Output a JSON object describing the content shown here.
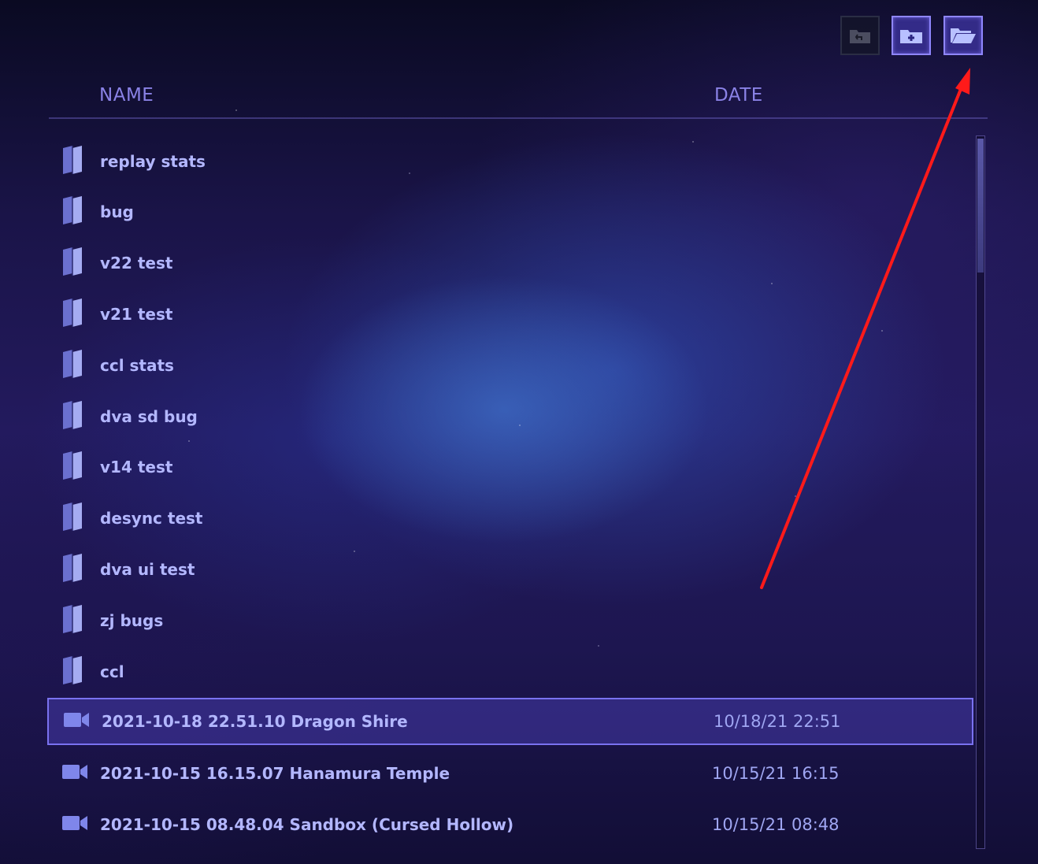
{
  "toolbar": {
    "buttons": [
      {
        "icon": "folder-back-icon",
        "state": "disabled"
      },
      {
        "icon": "new-folder-icon",
        "state": "enabled"
      },
      {
        "icon": "open-folder-icon",
        "state": "enabled"
      }
    ]
  },
  "header": {
    "name_label": "NAME",
    "date_label": "DATE"
  },
  "folders": [
    {
      "name": "replay stats"
    },
    {
      "name": "bug"
    },
    {
      "name": "v22 test"
    },
    {
      "name": "v21 test"
    },
    {
      "name": "ccl stats"
    },
    {
      "name": "dva sd bug"
    },
    {
      "name": "v14 test"
    },
    {
      "name": "desync test"
    },
    {
      "name": "dva ui test"
    },
    {
      "name": "zj bugs"
    },
    {
      "name": "ccl"
    }
  ],
  "replays": [
    {
      "name": "2021-10-18 22.51.10 Dragon Shire",
      "date": "10/18/21 22:51",
      "selected": true
    },
    {
      "name": "2021-10-15 16.15.07 Hanamura Temple",
      "date": "10/15/21 16:15",
      "selected": false
    },
    {
      "name": "2021-10-15 08.48.04 Sandbox (Cursed Hollow)",
      "date": "10/15/21 08:48",
      "selected": false
    }
  ],
  "colors": {
    "accent": "#8f86ff",
    "text": "#b3b7ff",
    "header_text": "#8a82e6",
    "annotation_arrow": "#ff1a1a"
  }
}
